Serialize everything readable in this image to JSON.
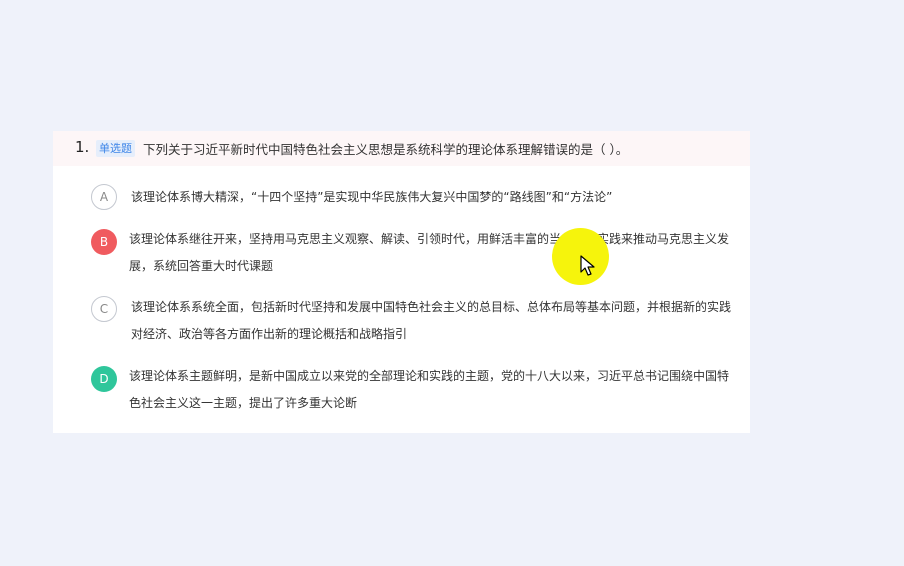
{
  "question": {
    "number": "1.",
    "type_badge": "单选题",
    "stem": "下列关于习近平新时代中国特色社会主义思想是系统科学的理论体系理解错误的是（      ）。"
  },
  "options": [
    {
      "letter": "A",
      "state": "unselected",
      "text": "该理论体系博大精深，“十四个坚持”是实现中华民族伟大复兴中国梦的“路线图”和“方法论”"
    },
    {
      "letter": "B",
      "state": "wrong",
      "text": "该理论体系继往开来，坚持用马克思主义观察、解读、引领时代，用鲜活丰富的当代中国实践来推动马克思主义发展，系统回答重大时代课题"
    },
    {
      "letter": "C",
      "state": "unselected",
      "text": "该理论体系系统全面，包括新时代坚持和发展中国特色社会主义的总目标、总体布局等基本问题，并根据新的实践对经济、政治等各方面作出新的理论概括和战略指引"
    },
    {
      "letter": "D",
      "state": "correct",
      "text": "该理论体系主题鲜明，是新中国成立以来党的全部理论和实践的主题，党的十八大以来，习近平总书记围绕中国特色社会主义这一主题，提出了许多重大论断"
    }
  ],
  "colors": {
    "page_bg": "#eff2fa",
    "header_bg": "#fdf6f7",
    "badge_text": "#3f86e8",
    "wrong": "#f05b5f",
    "correct": "#2fc69b",
    "cursor_highlight": "#f6f40c"
  },
  "icons": {
    "cursor": "mouse-pointer-icon"
  }
}
